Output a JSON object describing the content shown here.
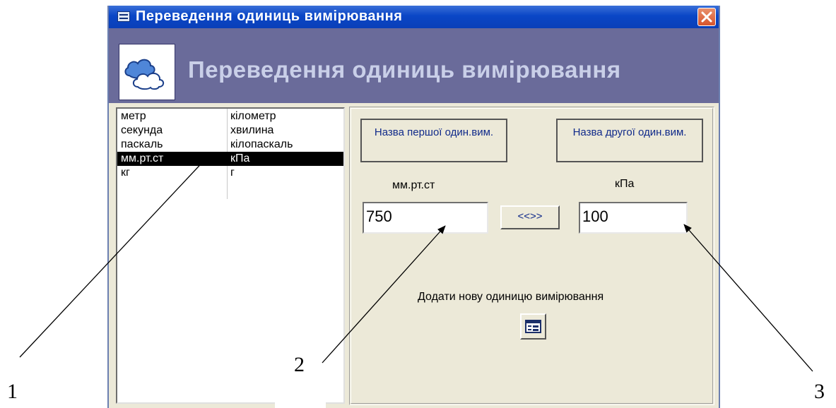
{
  "window": {
    "title": "Переведення одиниць вимірювання",
    "header_title": "Переведення одиниць вимірювання"
  },
  "units_list": {
    "rows": [
      {
        "first": "метр",
        "second": "кілометр",
        "selected": false
      },
      {
        "first": "секунда",
        "second": "хвилина",
        "selected": false
      },
      {
        "first": "паскаль",
        "second": "кілопаскаль",
        "selected": false
      },
      {
        "first": "мм.рт.ст",
        "second": "кПа",
        "selected": true
      },
      {
        "first": "кг",
        "second": "г",
        "selected": false
      }
    ]
  },
  "converter": {
    "first_name_label": "Назва першої один.вим.",
    "second_name_label": "Назва другої один.вим.",
    "first_unit": "мм.рт.ст",
    "second_unit": "кПа",
    "first_value": "750",
    "second_value": "100",
    "swap_label": "<<>>",
    "add_unit_label": "Додати нову одиницю вимірювання"
  },
  "annotations": [
    "1",
    "2",
    "3"
  ],
  "colors": {
    "titlebar": "#0a46c6",
    "header": "#6a6b9a",
    "header_text": "#c9cfe8",
    "selection": "#000000",
    "panel_bg": "#ece9d8"
  },
  "icons": [
    "form-icon",
    "close-icon",
    "clouds-logo-icon",
    "form-button-icon"
  ]
}
